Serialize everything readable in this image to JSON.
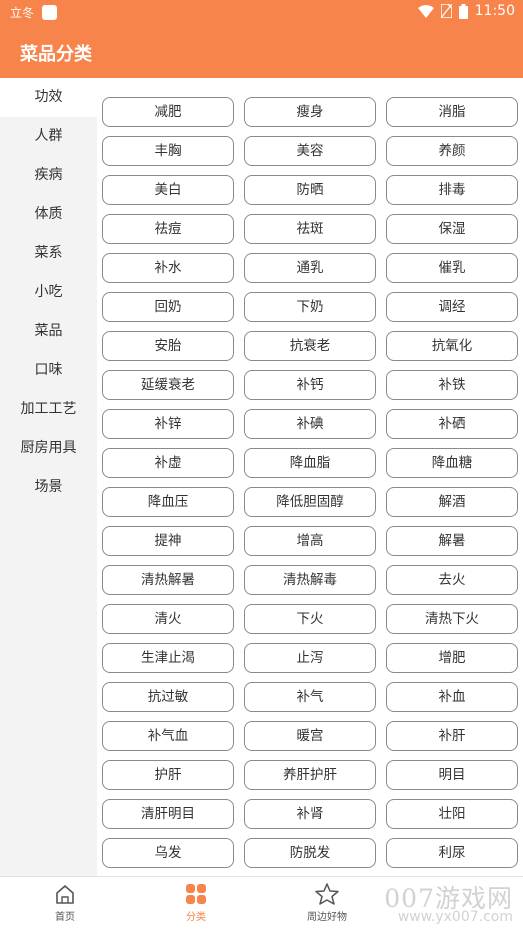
{
  "status_bar": {
    "carrier": "立冬",
    "time": "11:50"
  },
  "app_bar": {
    "title": "菜品分类"
  },
  "sidebar": {
    "items": [
      {
        "label": "功效",
        "active": true
      },
      {
        "label": "人群",
        "active": false
      },
      {
        "label": "疾病",
        "active": false
      },
      {
        "label": "体质",
        "active": false
      },
      {
        "label": "菜系",
        "active": false
      },
      {
        "label": "小吃",
        "active": false
      },
      {
        "label": "菜品",
        "active": false
      },
      {
        "label": "口味",
        "active": false
      },
      {
        "label": "加工工艺",
        "active": false
      },
      {
        "label": "厨房用具",
        "active": false
      },
      {
        "label": "场景",
        "active": false
      }
    ]
  },
  "tags": [
    "减肥",
    "瘦身",
    "消脂",
    "丰胸",
    "美容",
    "养颜",
    "美白",
    "防晒",
    "排毒",
    "祛痘",
    "祛斑",
    "保湿",
    "补水",
    "通乳",
    "催乳",
    "回奶",
    "下奶",
    "调经",
    "安胎",
    "抗衰老",
    "抗氧化",
    "延缓衰老",
    "补钙",
    "补铁",
    "补锌",
    "补碘",
    "补硒",
    "补虚",
    "降血脂",
    "降血糖",
    "降血压",
    "降低胆固醇",
    "解酒",
    "提神",
    "增高",
    "解暑",
    "清热解暑",
    "清热解毒",
    "去火",
    "清火",
    "下火",
    "清热下火",
    "生津止渴",
    "止泻",
    "增肥",
    "抗过敏",
    "补气",
    "补血",
    "补气血",
    "暖宫",
    "补肝",
    "护肝",
    "养肝护肝",
    "明目",
    "清肝明目",
    "补肾",
    "壮阳",
    "乌发",
    "防脱发",
    "利尿",
    "",
    "",
    ""
  ],
  "bottom_nav": {
    "items": [
      {
        "label": "首页",
        "icon": "home-icon",
        "active": false
      },
      {
        "label": "分类",
        "icon": "category-icon",
        "active": true
      },
      {
        "label": "周边好物",
        "icon": "star-icon",
        "active": false
      }
    ]
  },
  "watermark": {
    "line1": "007游戏网",
    "line2": "www.yx007.com"
  },
  "colors": {
    "accent": "#f7844a",
    "sidebar_bg": "#f3f3f3",
    "tag_border": "#8a8a8a"
  }
}
